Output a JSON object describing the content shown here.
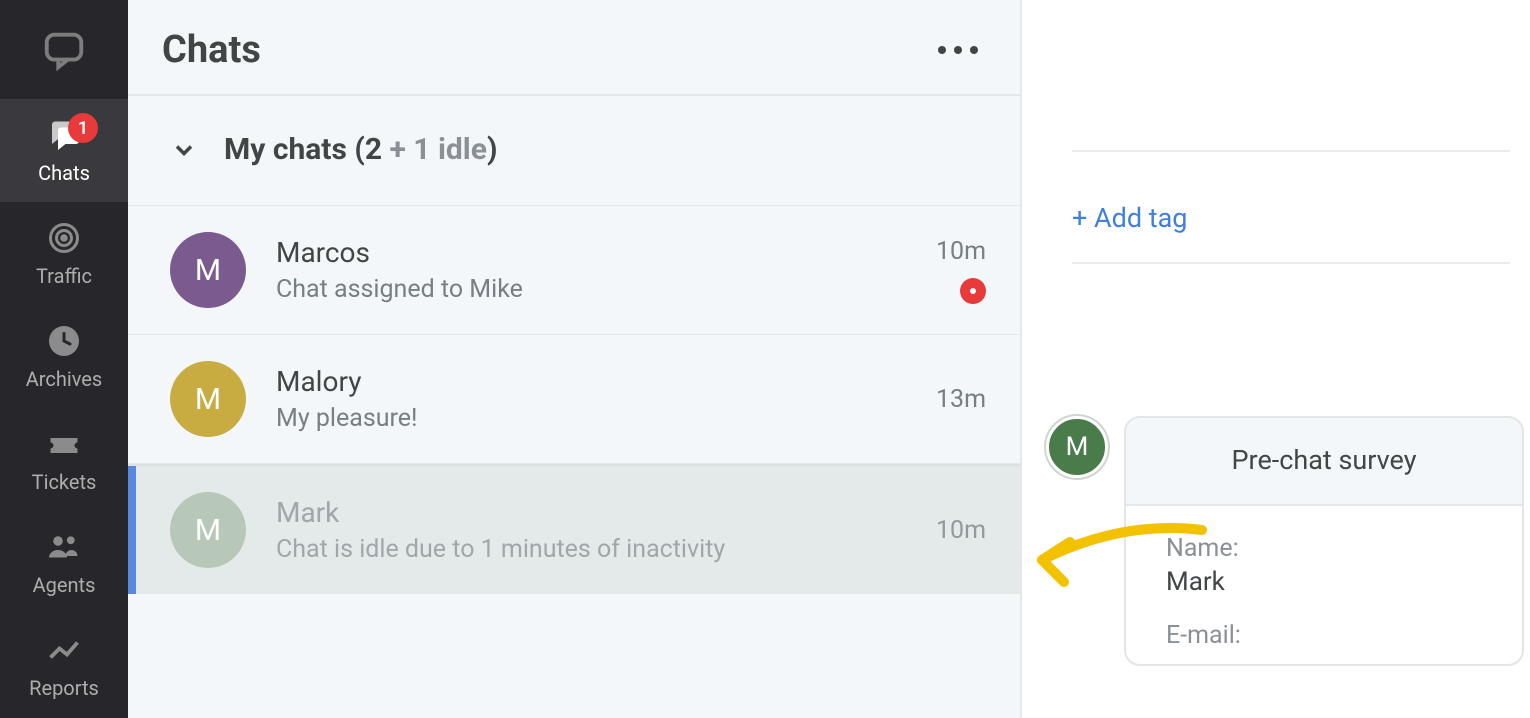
{
  "nav": {
    "badge": "1",
    "items": [
      {
        "id": "chats",
        "label": "Chats"
      },
      {
        "id": "traffic",
        "label": "Traffic"
      },
      {
        "id": "archives",
        "label": "Archives"
      },
      {
        "id": "tickets",
        "label": "Tickets"
      },
      {
        "id": "agents",
        "label": "Agents"
      },
      {
        "id": "reports",
        "label": "Reports"
      }
    ]
  },
  "list": {
    "title": "Chats",
    "section_prefix": "My chats",
    "section_count": "2",
    "section_idle": "+ 1 idle",
    "chats": [
      {
        "name": "Marcos",
        "preview": "Chat assigned to Mike",
        "time": "10m",
        "avatar_color": "#7a5a8f",
        "initial": "M",
        "alert": true
      },
      {
        "name": "Malory",
        "preview": "My pleasure!",
        "time": "13m",
        "avatar_color": "#c9ac41",
        "initial": "M",
        "alert": false
      },
      {
        "name": "Mark",
        "preview": "Chat is idle due to 1 minutes of inactivity",
        "time": "10m",
        "avatar_color": "#a8bca6",
        "initial": "M",
        "alert": false
      }
    ]
  },
  "right": {
    "add_tag": "+ Add tag",
    "survey_title": "Pre-chat survey",
    "survey_initial": "M",
    "fields": {
      "name_label": "Name:",
      "name_value": "Mark",
      "email_label": "E-mail:"
    }
  }
}
